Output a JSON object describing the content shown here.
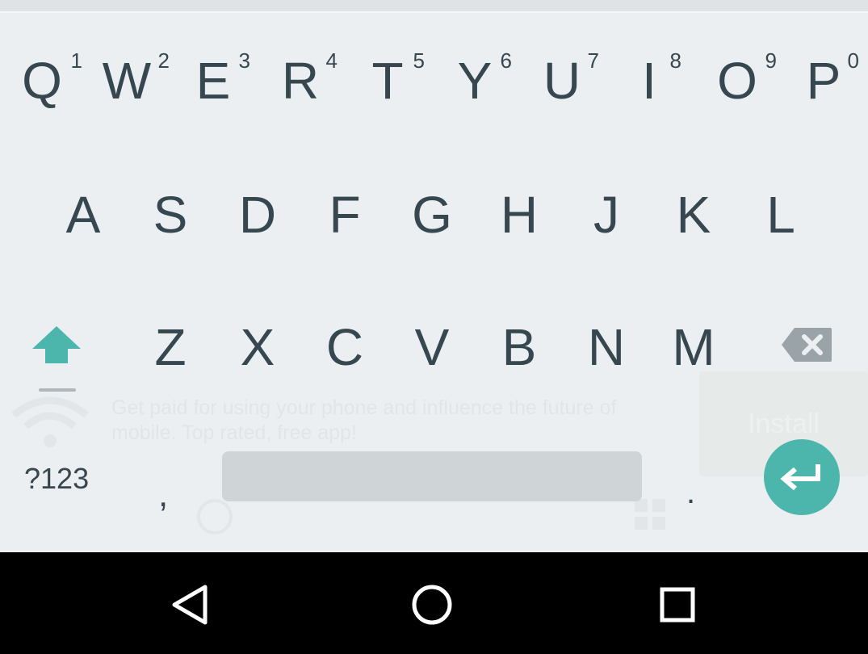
{
  "keyboard": {
    "row1": [
      {
        "letter": "Q",
        "hint": "1"
      },
      {
        "letter": "W",
        "hint": "2"
      },
      {
        "letter": "E",
        "hint": "3"
      },
      {
        "letter": "R",
        "hint": "4"
      },
      {
        "letter": "T",
        "hint": "5"
      },
      {
        "letter": "Y",
        "hint": "6"
      },
      {
        "letter": "U",
        "hint": "7"
      },
      {
        "letter": "I",
        "hint": "8"
      },
      {
        "letter": "O",
        "hint": "9"
      },
      {
        "letter": "P",
        "hint": "0"
      }
    ],
    "row2": [
      "A",
      "S",
      "D",
      "F",
      "G",
      "H",
      "J",
      "K",
      "L"
    ],
    "row3": [
      "Z",
      "X",
      "C",
      "V",
      "B",
      "N",
      "M"
    ],
    "symbols_label": "?123",
    "comma": ",",
    "period": ".",
    "accent_color": "#4db6ac",
    "key_text_color": "#37474f",
    "background_color": "#eceff1"
  },
  "background_ad": {
    "text": "Get paid for using your phone and influence the future of mobile. Top rated, free app!",
    "button_label": "Install"
  },
  "navbar": {
    "back_icon": "back-triangle-icon",
    "home_icon": "home-circle-icon",
    "recents_icon": "recents-square-icon"
  }
}
